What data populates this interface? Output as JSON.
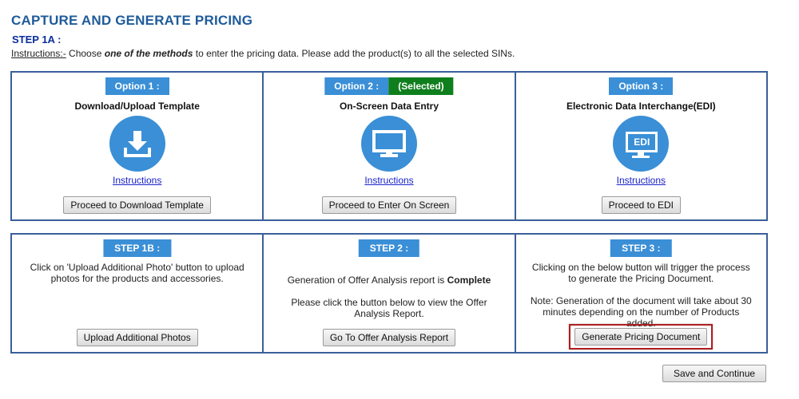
{
  "page": {
    "title": "CAPTURE AND GENERATE PRICING",
    "step_label": "STEP 1A :",
    "instructions": {
      "prefix": "Instructions:-",
      "text1": " Choose ",
      "emphasis": "one of the methods",
      "text2": " to enter the pricing data. Please add the product(s) to all the selected SINs."
    }
  },
  "options": [
    {
      "badge": "Option 1 :",
      "title": "Download/Upload Template",
      "icon": "download-icon",
      "link": "Instructions",
      "button": "Proceed to Download Template"
    },
    {
      "badge": "Option 2 :",
      "selected": "(Selected)",
      "title": "On-Screen Data Entry",
      "icon": "monitor-icon",
      "link": "Instructions",
      "button": "Proceed to Enter On Screen"
    },
    {
      "badge": "Option 3 :",
      "title": "Electronic Data Interchange(EDI)",
      "icon": "edi-icon",
      "icon_text": "EDI",
      "link": "Instructions",
      "button": "Proceed to EDI"
    }
  ],
  "steps": [
    {
      "badge": "STEP 1B :",
      "text": "Click on 'Upload Additional Photo' button to upload photos for the products and accessories.",
      "button": "Upload Additional Photos"
    },
    {
      "badge": "STEP 2 :",
      "text_prefix": "Generation of Offer Analysis report is ",
      "text_bold": "Complete",
      "text2": "Please click the button below to view the Offer Analysis Report.",
      "button": "Go To Offer Analysis Report"
    },
    {
      "badge": "STEP 3 :",
      "text": "Clicking on the below button will trigger the process to generate the Pricing Document.",
      "note": "Note: Generation of the document will take about 30 minutes depending on the number of Products added.",
      "button": "Generate Pricing Document"
    }
  ],
  "footer": {
    "save_button": "Save and Continue"
  },
  "colors": {
    "title": "#1f5b99",
    "badge": "#3a8fd6",
    "selected": "#0f7f1d",
    "border": "#3b5f9a",
    "highlight": "#b01e1e"
  }
}
